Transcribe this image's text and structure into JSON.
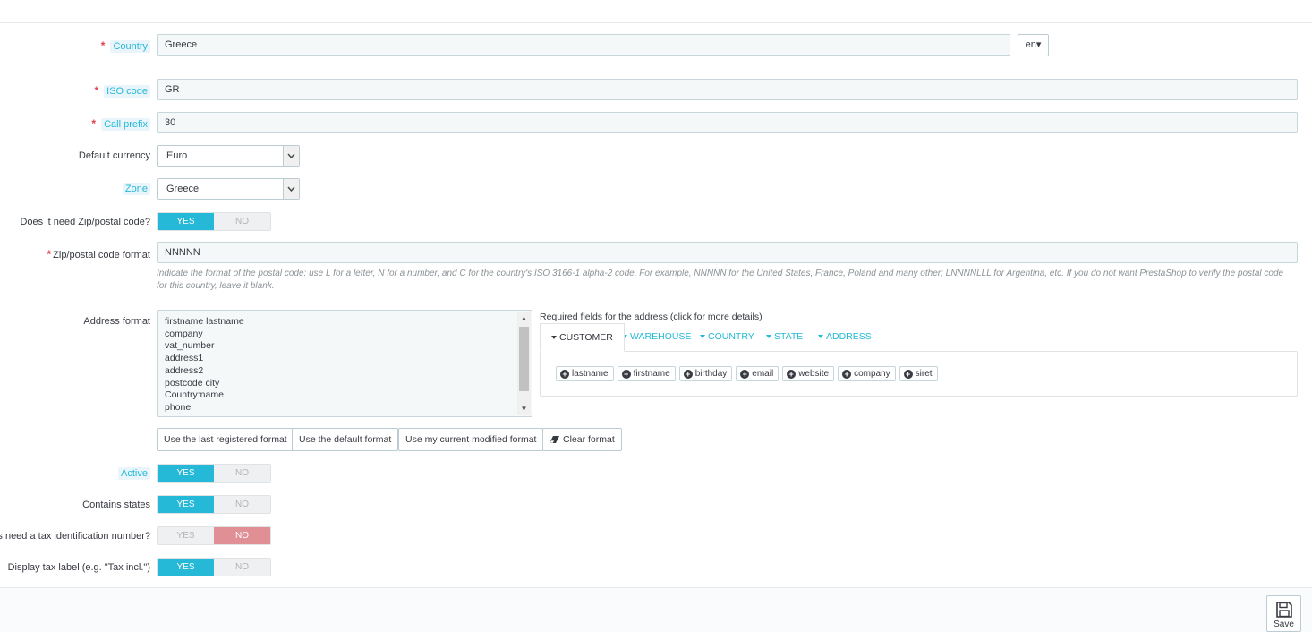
{
  "fields": {
    "country": {
      "label": "Country",
      "value": "Greece",
      "lang": "en"
    },
    "iso_code": {
      "label": "ISO code",
      "value": "GR"
    },
    "call_prefix": {
      "label": "Call prefix",
      "value": "30"
    },
    "default_currency": {
      "label": "Default currency",
      "value": "Euro"
    },
    "zone": {
      "label": "Zone",
      "value": "Greece"
    },
    "need_zip": {
      "label": "Does it need Zip/postal code?",
      "yes": "YES",
      "no": "NO",
      "selected": "yes"
    },
    "zip_format": {
      "label": "Zip/postal code format",
      "value": "NNNNN",
      "help": "Indicate the format of the postal code: use L for a letter, N for a number, and C for the country's ISO 3166-1 alpha-2 code. For example, NNNNN for the United States, France, Poland and many other; LNNNNLLL for Argentina, etc. If you do not want PrestaShop to verify the postal code for this country, leave it blank."
    },
    "address_format": {
      "label": "Address format",
      "lines": [
        "firstname lastname",
        "company",
        "vat_number",
        "address1",
        "address2",
        "postcode city",
        "Country:name",
        "phone"
      ]
    },
    "active": {
      "label": "Active",
      "yes": "YES",
      "no": "NO",
      "selected": "yes"
    },
    "contains_states": {
      "label": "Contains states",
      "yes": "YES",
      "no": "NO",
      "selected": "yes"
    },
    "need_tax_id": {
      "label": "s need a tax identification number?",
      "yes": "YES",
      "no": "NO",
      "selected": "no"
    },
    "display_tax_label": {
      "label": "Display tax label (e.g. \"Tax incl.\")",
      "yes": "YES",
      "no": "NO",
      "selected": "yes"
    }
  },
  "required_fields": {
    "title": "Required fields for the address (click for more details)",
    "tabs": [
      "CUSTOMER",
      "WAREHOUSE",
      "COUNTRY",
      "STATE",
      "ADDRESS"
    ],
    "active_tab": "CUSTOMER",
    "chips": [
      "lastname",
      "firstname",
      "birthday",
      "email",
      "website",
      "company",
      "siret"
    ]
  },
  "buttons": {
    "last_registered": "Use the last registered format",
    "default_format": "Use the default format",
    "current_modified": "Use my current modified format",
    "clear_format": "Clear format"
  },
  "footer": {
    "save": "Save"
  },
  "colors": {
    "accent": "#25b9d7",
    "danger": "#e08f95",
    "required": "#e0414b"
  }
}
